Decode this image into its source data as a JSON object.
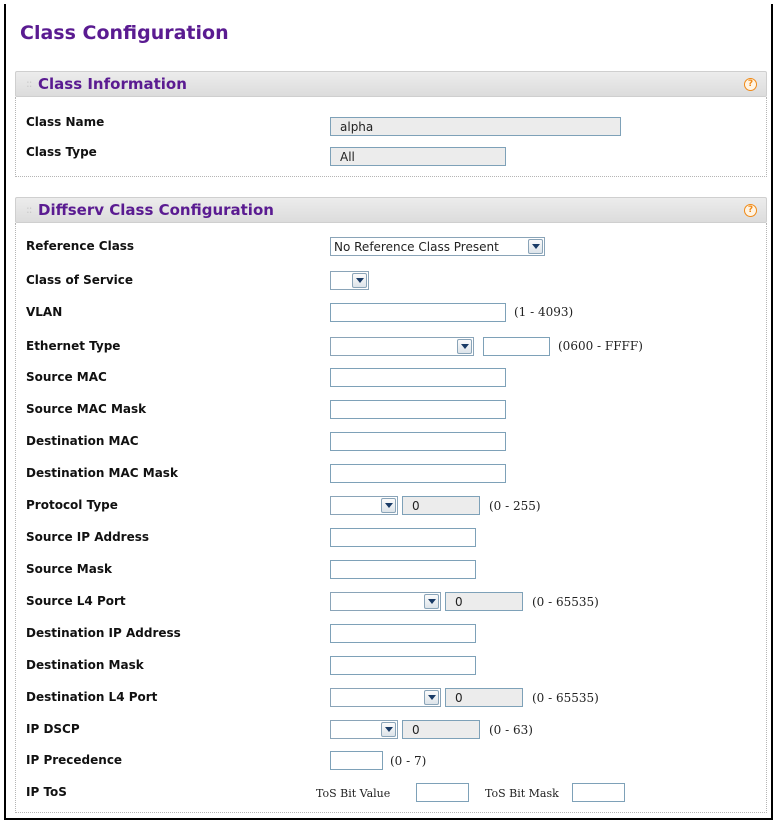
{
  "page_title": "Class Configuration",
  "colors": {
    "title": "#5a1b91",
    "help_icon": "#f08a17",
    "input_border": "#7ea1b8"
  },
  "class_information": {
    "title": "Class Information",
    "help_icon": "?",
    "class_name_label": "Class Name",
    "class_name_value": "alpha",
    "class_type_label": "Class Type",
    "class_type_value": "All"
  },
  "diffserv": {
    "title": "Diffserv Class Configuration",
    "help_icon": "?",
    "reference_class": {
      "label": "Reference Class",
      "value": "No Reference Class Present"
    },
    "class_of_service": {
      "label": "Class of Service",
      "value": ""
    },
    "vlan": {
      "label": "VLAN",
      "value": "",
      "range": "(1 - 4093)"
    },
    "ethernet_type": {
      "label": "Ethernet Type",
      "select_value": "",
      "value": "",
      "range": "(0600 - FFFF)"
    },
    "source_mac": {
      "label": "Source MAC",
      "value": ""
    },
    "source_mac_mask": {
      "label": "Source MAC Mask",
      "value": ""
    },
    "destination_mac": {
      "label": "Destination MAC",
      "value": ""
    },
    "destination_mac_mask": {
      "label": "Destination MAC Mask",
      "value": ""
    },
    "protocol_type": {
      "label": "Protocol Type",
      "select_value": "",
      "value": "0",
      "range": "(0 - 255)"
    },
    "source_ip_address": {
      "label": "Source IP Address",
      "value": ""
    },
    "source_mask": {
      "label": "Source Mask",
      "value": ""
    },
    "source_l4_port": {
      "label": "Source L4 Port",
      "select_value": "",
      "value": "0",
      "range": "(0 - 65535)"
    },
    "destination_ip_address": {
      "label": "Destination IP Address",
      "value": ""
    },
    "destination_mask": {
      "label": "Destination Mask",
      "value": ""
    },
    "destination_l4_port": {
      "label": "Destination L4 Port",
      "select_value": "",
      "value": "0",
      "range": "(0 - 65535)"
    },
    "ip_dscp": {
      "label": "IP DSCP",
      "select_value": "",
      "value": "0",
      "range": "(0 - 63)"
    },
    "ip_precedence": {
      "label": "IP Precedence",
      "value": "",
      "range": "(0 - 7)"
    },
    "ip_tos": {
      "label": "IP ToS",
      "tos_bit_value_label": "ToS Bit Value",
      "tos_bit_value": "",
      "tos_bit_mask_label": "ToS Bit Mask",
      "tos_bit_mask": ""
    }
  }
}
